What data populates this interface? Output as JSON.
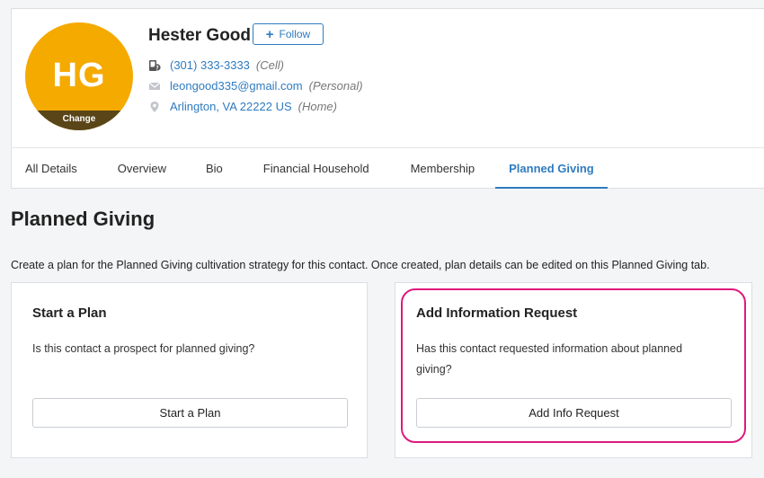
{
  "contact": {
    "initials": "HG",
    "change_label": "Change",
    "name": "Hester Good",
    "follow_label": "Follow",
    "phone": "(301) 333-3333",
    "phone_type": "(Cell)",
    "email": "leongood335@gmail.com",
    "email_type": "(Personal)",
    "address": "Arlington, VA 22222 US",
    "address_type": "(Home)"
  },
  "tabs": [
    {
      "label": "All Details"
    },
    {
      "label": "Overview"
    },
    {
      "label": "Bio"
    },
    {
      "label": "Financial Household"
    },
    {
      "label": "Membership"
    },
    {
      "label": "Planned Giving"
    }
  ],
  "page": {
    "title": "Planned Giving",
    "intro": "Create a plan for the Planned Giving cultivation strategy for this contact. Once created, plan details can be edited on this Planned Giving tab."
  },
  "cards": {
    "start_plan": {
      "title": "Start a Plan",
      "text": "Is this contact a prospect for planned giving?",
      "button": "Start a Plan"
    },
    "info_request": {
      "title": "Add Information Request",
      "text_line1": "Has this contact requested information about planned",
      "text_line2": "giving?",
      "button": "Add Info Request"
    }
  },
  "colors": {
    "avatar": "#f5aa00",
    "accent": "#2f7bbf",
    "highlight": "#e0187e"
  }
}
